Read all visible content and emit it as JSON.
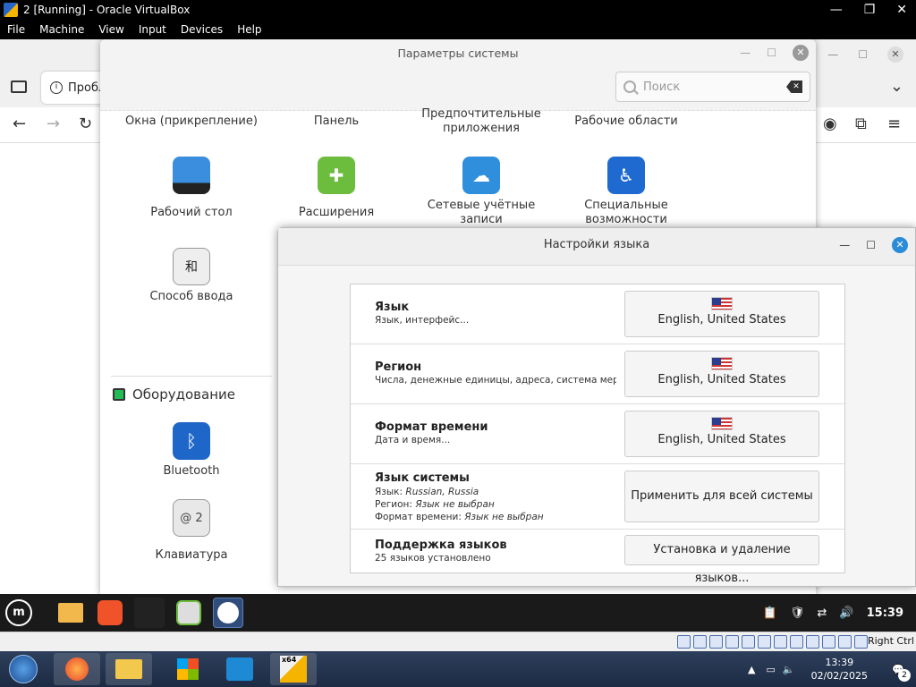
{
  "host": {
    "title": "2 [Running] - Oracle VirtualBox",
    "menu": [
      "File",
      "Machine",
      "View",
      "Input",
      "Devices",
      "Help"
    ],
    "ctrl_minimize": "—",
    "ctrl_maximize": "❐",
    "ctrl_close": "✕"
  },
  "browser": {
    "tab_label": "Пробл",
    "info_glyph": "i",
    "back": "←",
    "forward": "→",
    "reload": "↻",
    "chevron": "⌄",
    "account": "◉",
    "extensions": "⧉",
    "menu": "≡",
    "ctrl_min": "—",
    "ctrl_max": "☐",
    "ctrl_close": "✕"
  },
  "settings": {
    "title": "Параметры системы",
    "search_placeholder": "Поиск",
    "ctrl_min": "—",
    "ctrl_max": "☐",
    "ctrl_close": "✕",
    "row1": [
      "Окна (прикрепление)",
      "Панель",
      "Предпочтительные приложения",
      "Рабочие области"
    ],
    "row2": [
      "Рабочий стол",
      "Расширения",
      "Сетевые учётные записи",
      "Специальные возможности"
    ],
    "input_method": "Способ ввода",
    "input_glyph": "和",
    "hardware_title": "Оборудование",
    "bluetooth": "Bluetooth",
    "bluetooth_glyph": "ᛒ",
    "keyboard": "Клавиатура",
    "keyboard_glyph": "@ 2"
  },
  "lang": {
    "title": "Настройки языка",
    "ctrl_min": "—",
    "ctrl_max": "☐",
    "ctrl_close": "✕",
    "rows": [
      {
        "name": "Язык",
        "desc": "Язык, интерфейс...",
        "value": "English, United States"
      },
      {
        "name": "Регион",
        "desc": "Числа, денежные единицы, адреса, система мер...",
        "value": "English, United States"
      },
      {
        "name": "Формат времени",
        "desc": "Дата и время...",
        "value": "English, United States"
      }
    ],
    "system": {
      "name": "Язык системы",
      "lang_label": "Язык:",
      "lang_value": "Russian, Russia",
      "region_label": "Регион:",
      "region_value": "Язык не выбран",
      "time_label": "Формат времени:",
      "time_value": "Язык не выбран",
      "button": "Применить для всей системы"
    },
    "support": {
      "name": "Поддержка языков",
      "desc": "25 языков установлено",
      "button": "Установка и удаление языков..."
    }
  },
  "mint_taskbar": {
    "clock": "15:39",
    "terminal_glyph": "$_"
  },
  "vb_status": {
    "host_key": "Right Ctrl"
  },
  "win_taskbar": {
    "time": "13:39",
    "date": "02/02/2025",
    "notifications": "2",
    "vbox_badge": "x64"
  }
}
